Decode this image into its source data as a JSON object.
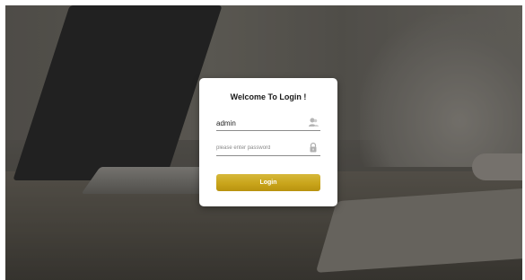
{
  "login": {
    "title": "Welcome To Login !",
    "username_value": "admin",
    "password_placeholder": "please enter password",
    "login_button_label": "Login"
  },
  "icons": {
    "user_field": "user-icon",
    "password_field": "lock-icon"
  },
  "colors": {
    "button_gold": "#c9a51b",
    "card_bg": "#ffffff",
    "field_underline": "#8c8c8c"
  }
}
